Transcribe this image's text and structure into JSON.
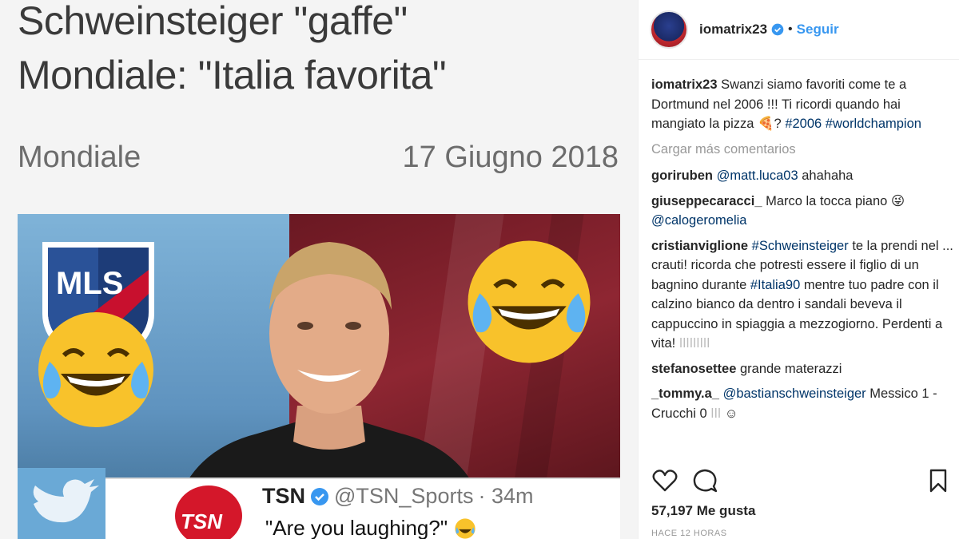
{
  "image": {
    "article_title_line1": "Schweinsteiger \"gaffe\"",
    "article_title_line2": "Mondiale: \"Italia favorita\"",
    "category": "Mondiale",
    "date": "17 Giugno 2018",
    "logo_text": "MLS",
    "tweet_brand": "TSN",
    "tweet_handle": "@TSN_Sports",
    "tweet_time": "· 34m",
    "tweet_text": "\"Are you laughing?\"",
    "tsn_logo_text": "TSN"
  },
  "header": {
    "username": "iomatrix23",
    "separator": "•",
    "follow_label": "Seguir"
  },
  "caption": {
    "user": "iomatrix23",
    "text": "Swanzi siamo favoriti come te a Dortmund nel 2006 !!! Ti ricordi quando hai mangiato la pizza 🍕?",
    "tag1": "#2006",
    "tag2": "#worldchampion"
  },
  "load_more_label": "Cargar más comentarios",
  "comments": [
    {
      "user": "goriruben",
      "mention": "@matt.luca03",
      "text": "ahahaha"
    },
    {
      "user": "giuseppecaracci_",
      "text": "Marco la tocca piano 😜",
      "mention": "@calogeromelia"
    },
    {
      "user": "cristianviglione",
      "tag": "#Schweinsteiger",
      "text_a": "te la prendi nel ... crauti!",
      "text_b": "ricorda che potresti essere il figlio di un bagnino durante",
      "tag2": "#Italia90",
      "text_c": "mentre tuo padre con il calzino bianco da dentro i sandali beveva il cappuccino in spiaggia a mezzogiorno. Perdenti a vita!",
      "trail": "ǀǀǀǀǀǀǀǀǀ"
    },
    {
      "user": "stefanosettee",
      "text": "grande materazzi"
    },
    {
      "user": "_tommy.a_",
      "mention": "@bastianschweinsteiger",
      "text": "Messico 1 - Crucchi 0",
      "trail": "ǀǀǀ",
      "emoji": "☺"
    }
  ],
  "likes_label": "57,197 Me gusta",
  "timestamp": "HACE 12 HORAS",
  "icons": {
    "like": "heart-icon",
    "comment": "comment-bubble-icon",
    "save": "bookmark-icon",
    "verified": "verified-badge-icon"
  },
  "colors": {
    "link": "#003569",
    "follow": "#3897f0",
    "verified": "#3897f0"
  }
}
